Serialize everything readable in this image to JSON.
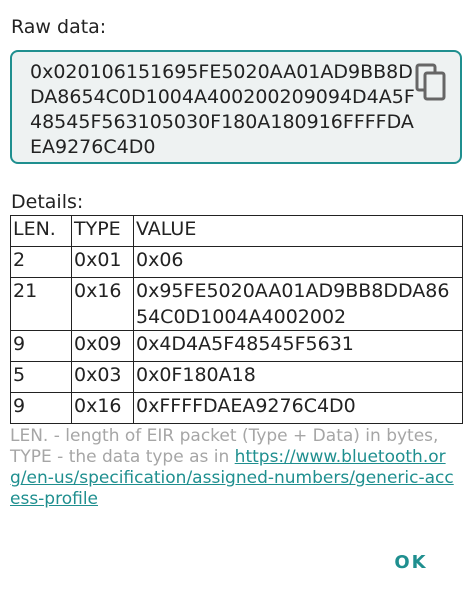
{
  "raw": {
    "label": "Raw data:",
    "value": "0x020106151695FE5020AA01AD9BB8DDA8654C0D1004A400200209094D4A5F48545F563105030F180A180916FFFFDAEA9276C4D0",
    "copy_icon": "copy-icon"
  },
  "details": {
    "label": "Details:",
    "headers": [
      "LEN.",
      "TYPE",
      "VALUE"
    ],
    "rows": [
      {
        "len": "2",
        "type": "0x01",
        "value": "0x06"
      },
      {
        "len": "21",
        "type": "0x16",
        "value": "0x95FE5020AA01AD9BB8DDA8654C0D1004A4002002"
      },
      {
        "len": "9",
        "type": "0x09",
        "value": "0x4D4A5F48545F5631"
      },
      {
        "len": "5",
        "type": "0x03",
        "value": "0x0F180A18"
      },
      {
        "len": "9",
        "type": "0x16",
        "value": "0xFFFFDAEA9276C4D0"
      }
    ]
  },
  "footnote": {
    "text": "LEN. - length of EIR packet (Type + Data) in bytes, TYPE - the data type as in ",
    "link": "https://www.bluetooth.org/en-us/specification/assigned-numbers/generic-access-profile"
  },
  "ok_label": "OK",
  "colors": {
    "accent": "#1f8f8f",
    "box_bg": "#eef2f2",
    "footnote": "#a6a6a6"
  }
}
